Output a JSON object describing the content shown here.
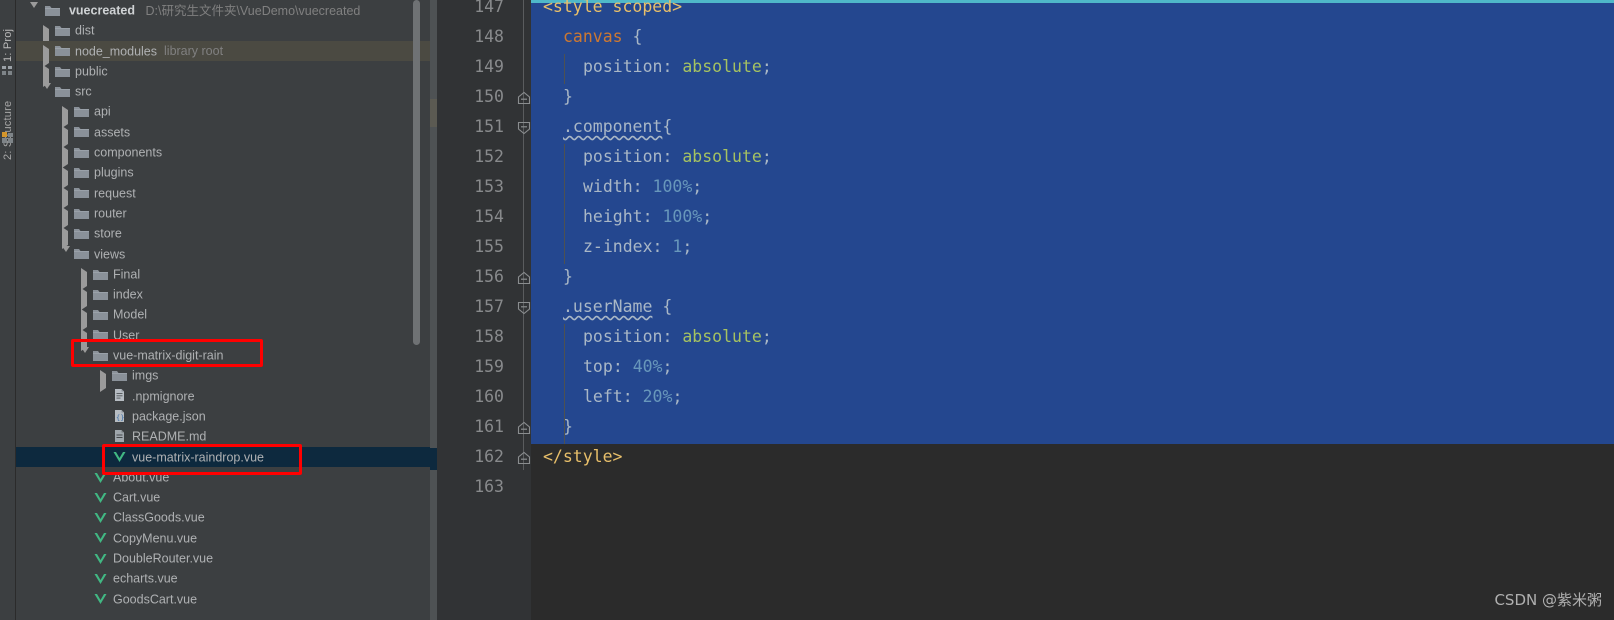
{
  "toolwindow_tabs": [
    {
      "name": "project",
      "label": "1: Proj"
    },
    {
      "name": "structure",
      "label": "2: Structure"
    }
  ],
  "project_tree": {
    "root": {
      "label": "vuecreated",
      "path": "D:\\研究生文件夹\\VueDemo\\vuecreated",
      "icon": "folder-icon",
      "arrow": "chevron-down-icon"
    },
    "rows": [
      {
        "label": "dist",
        "sub": "",
        "indent": 1,
        "icon": "folder-icon",
        "arrow": "chevron-right-icon",
        "state": "normal"
      },
      {
        "label": "node_modules",
        "sub": "library root",
        "indent": 1,
        "icon": "folder-icon",
        "arrow": "chevron-right-icon",
        "state": "hover"
      },
      {
        "label": "public",
        "sub": "",
        "indent": 1,
        "icon": "folder-icon",
        "arrow": "chevron-right-icon",
        "state": "normal"
      },
      {
        "label": "src",
        "sub": "",
        "indent": 1,
        "icon": "folder-icon",
        "arrow": "chevron-down-icon",
        "state": "normal"
      },
      {
        "label": "api",
        "sub": "",
        "indent": 2,
        "icon": "folder-icon",
        "arrow": "chevron-right-icon",
        "state": "normal"
      },
      {
        "label": "assets",
        "sub": "",
        "indent": 2,
        "icon": "folder-icon",
        "arrow": "chevron-right-icon",
        "state": "normal"
      },
      {
        "label": "components",
        "sub": "",
        "indent": 2,
        "icon": "folder-icon",
        "arrow": "chevron-right-icon",
        "state": "normal"
      },
      {
        "label": "plugins",
        "sub": "",
        "indent": 2,
        "icon": "folder-icon",
        "arrow": "chevron-right-icon",
        "state": "normal"
      },
      {
        "label": "request",
        "sub": "",
        "indent": 2,
        "icon": "folder-icon",
        "arrow": "chevron-right-icon",
        "state": "normal"
      },
      {
        "label": "router",
        "sub": "",
        "indent": 2,
        "icon": "folder-icon",
        "arrow": "chevron-right-icon",
        "state": "normal"
      },
      {
        "label": "store",
        "sub": "",
        "indent": 2,
        "icon": "folder-icon",
        "arrow": "chevron-right-icon",
        "state": "normal"
      },
      {
        "label": "views",
        "sub": "",
        "indent": 2,
        "icon": "folder-icon",
        "arrow": "chevron-down-icon",
        "state": "normal"
      },
      {
        "label": "Final",
        "sub": "",
        "indent": 3,
        "icon": "folder-icon",
        "arrow": "chevron-right-icon",
        "state": "normal"
      },
      {
        "label": "index",
        "sub": "",
        "indent": 3,
        "icon": "folder-icon",
        "arrow": "chevron-right-icon",
        "state": "normal"
      },
      {
        "label": "Model",
        "sub": "",
        "indent": 3,
        "icon": "folder-icon",
        "arrow": "chevron-right-icon",
        "state": "normal"
      },
      {
        "label": "User",
        "sub": "",
        "indent": 3,
        "icon": "folder-icon",
        "arrow": "chevron-right-icon",
        "state": "normal"
      },
      {
        "label": "vue-matrix-digit-rain",
        "sub": "",
        "indent": 3,
        "icon": "folder-icon",
        "arrow": "chevron-down-icon",
        "state": "normal"
      },
      {
        "label": "imgs",
        "sub": "",
        "indent": 4,
        "icon": "folder-icon",
        "arrow": "chevron-right-icon",
        "state": "normal"
      },
      {
        "label": ".npmignore",
        "sub": "",
        "indent": 4,
        "icon": "text-file-icon",
        "arrow": "none",
        "state": "normal"
      },
      {
        "label": "package.json",
        "sub": "",
        "indent": 4,
        "icon": "json-file-icon",
        "arrow": "none",
        "state": "normal"
      },
      {
        "label": "README.md",
        "sub": "",
        "indent": 4,
        "icon": "markdown-file-icon",
        "arrow": "none",
        "state": "normal"
      },
      {
        "label": "vue-matrix-raindrop.vue",
        "sub": "",
        "indent": 4,
        "icon": "vue-file-icon",
        "arrow": "none",
        "state": "selected"
      },
      {
        "label": "About.vue",
        "sub": "",
        "indent": 3,
        "icon": "vue-file-icon",
        "arrow": "none",
        "state": "normal"
      },
      {
        "label": "Cart.vue",
        "sub": "",
        "indent": 3,
        "icon": "vue-file-icon",
        "arrow": "none",
        "state": "normal"
      },
      {
        "label": "ClassGoods.vue",
        "sub": "",
        "indent": 3,
        "icon": "vue-file-icon",
        "arrow": "none",
        "state": "normal"
      },
      {
        "label": "CopyMenu.vue",
        "sub": "",
        "indent": 3,
        "icon": "vue-file-icon",
        "arrow": "none",
        "state": "normal"
      },
      {
        "label": "DoubleRouter.vue",
        "sub": "",
        "indent": 3,
        "icon": "vue-file-icon",
        "arrow": "none",
        "state": "normal"
      },
      {
        "label": "echarts.vue",
        "sub": "",
        "indent": 3,
        "icon": "vue-file-icon",
        "arrow": "none",
        "state": "normal"
      },
      {
        "label": "GoodsCart.vue",
        "sub": "",
        "indent": 3,
        "icon": "vue-file-icon",
        "arrow": "none",
        "state": "normal"
      }
    ]
  },
  "editor": {
    "first_visible_line": 147,
    "lines": [
      {
        "num": 147,
        "indent": 0,
        "tokens": [
          {
            "t": "<style scoped>",
            "c": "tag"
          }
        ],
        "fold": "",
        "clipped": true
      },
      {
        "num": 148,
        "indent": 2,
        "tokens": [
          {
            "t": "canvas",
            "c": "sel"
          },
          {
            "t": " {",
            "c": "brace"
          }
        ],
        "fold": ""
      },
      {
        "num": 149,
        "indent": 4,
        "tokens": [
          {
            "t": "position",
            "c": "prop"
          },
          {
            "t": ": ",
            "c": "punct"
          },
          {
            "t": "absolute",
            "c": "val"
          },
          {
            "t": ";",
            "c": "punct"
          }
        ],
        "fold": ""
      },
      {
        "num": 150,
        "indent": 2,
        "tokens": [
          {
            "t": "}",
            "c": "brace"
          }
        ],
        "fold": "end"
      },
      {
        "num": 151,
        "indent": 2,
        "tokens": [
          {
            "t": ".component",
            "c": "class-wavy"
          },
          {
            "t": "{",
            "c": "brace"
          }
        ],
        "fold": "start"
      },
      {
        "num": 152,
        "indent": 4,
        "tokens": [
          {
            "t": "position",
            "c": "prop"
          },
          {
            "t": ": ",
            "c": "punct"
          },
          {
            "t": "absolute",
            "c": "val"
          },
          {
            "t": ";",
            "c": "punct"
          }
        ],
        "fold": ""
      },
      {
        "num": 153,
        "indent": 4,
        "tokens": [
          {
            "t": "width",
            "c": "prop"
          },
          {
            "t": ": ",
            "c": "punct"
          },
          {
            "t": "100%",
            "c": "num"
          },
          {
            "t": ";",
            "c": "punct"
          }
        ],
        "fold": ""
      },
      {
        "num": 154,
        "indent": 4,
        "tokens": [
          {
            "t": "height",
            "c": "prop"
          },
          {
            "t": ": ",
            "c": "punct"
          },
          {
            "t": "100%",
            "c": "num"
          },
          {
            "t": ";",
            "c": "punct"
          }
        ],
        "fold": ""
      },
      {
        "num": 155,
        "indent": 4,
        "tokens": [
          {
            "t": "z-index",
            "c": "prop"
          },
          {
            "t": ": ",
            "c": "punct"
          },
          {
            "t": "1",
            "c": "num"
          },
          {
            "t": ";",
            "c": "punct"
          }
        ],
        "fold": ""
      },
      {
        "num": 156,
        "indent": 2,
        "tokens": [
          {
            "t": "}",
            "c": "brace"
          }
        ],
        "fold": "end"
      },
      {
        "num": 157,
        "indent": 2,
        "tokens": [
          {
            "t": ".userName",
            "c": "class-wavy"
          },
          {
            "t": " {",
            "c": "brace"
          }
        ],
        "fold": "start"
      },
      {
        "num": 158,
        "indent": 4,
        "tokens": [
          {
            "t": "position",
            "c": "prop"
          },
          {
            "t": ": ",
            "c": "punct"
          },
          {
            "t": "absolute",
            "c": "val"
          },
          {
            "t": ";",
            "c": "punct"
          }
        ],
        "fold": ""
      },
      {
        "num": 159,
        "indent": 4,
        "tokens": [
          {
            "t": "top",
            "c": "prop"
          },
          {
            "t": ": ",
            "c": "punct"
          },
          {
            "t": "40%",
            "c": "num"
          },
          {
            "t": ";",
            "c": "punct"
          }
        ],
        "fold": ""
      },
      {
        "num": 160,
        "indent": 4,
        "tokens": [
          {
            "t": "left",
            "c": "prop"
          },
          {
            "t": ": ",
            "c": "punct"
          },
          {
            "t": "20%",
            "c": "num"
          },
          {
            "t": ";",
            "c": "punct"
          }
        ],
        "fold": ""
      },
      {
        "num": 161,
        "indent": 2,
        "tokens": [
          {
            "t": "}",
            "c": "brace"
          }
        ],
        "fold": "end"
      },
      {
        "num": 162,
        "indent": 0,
        "tokens": [
          {
            "t": "</style>",
            "c": "tag"
          }
        ],
        "fold": "end"
      },
      {
        "num": 163,
        "indent": 0,
        "tokens": [],
        "fold": ""
      }
    ]
  },
  "watermark": {
    "text": "CSDN @紫米粥"
  },
  "colors": {
    "panel_bg": "#3c3f41",
    "editor_bg": "#2b2b2b",
    "gutter_bg": "#313335",
    "selection_blue": "#24478f",
    "tree_selection": "#0d293e",
    "annotation_red": "#ff0000",
    "accent_cyan": "#4fb8c9",
    "vue_green": "#41b883",
    "keyword_orange": "#cc7832",
    "string_green": "#a5c261",
    "number_blue": "#6897bb",
    "tag_yellow": "#e8bf6a",
    "text_gray": "#a9b7c6"
  }
}
